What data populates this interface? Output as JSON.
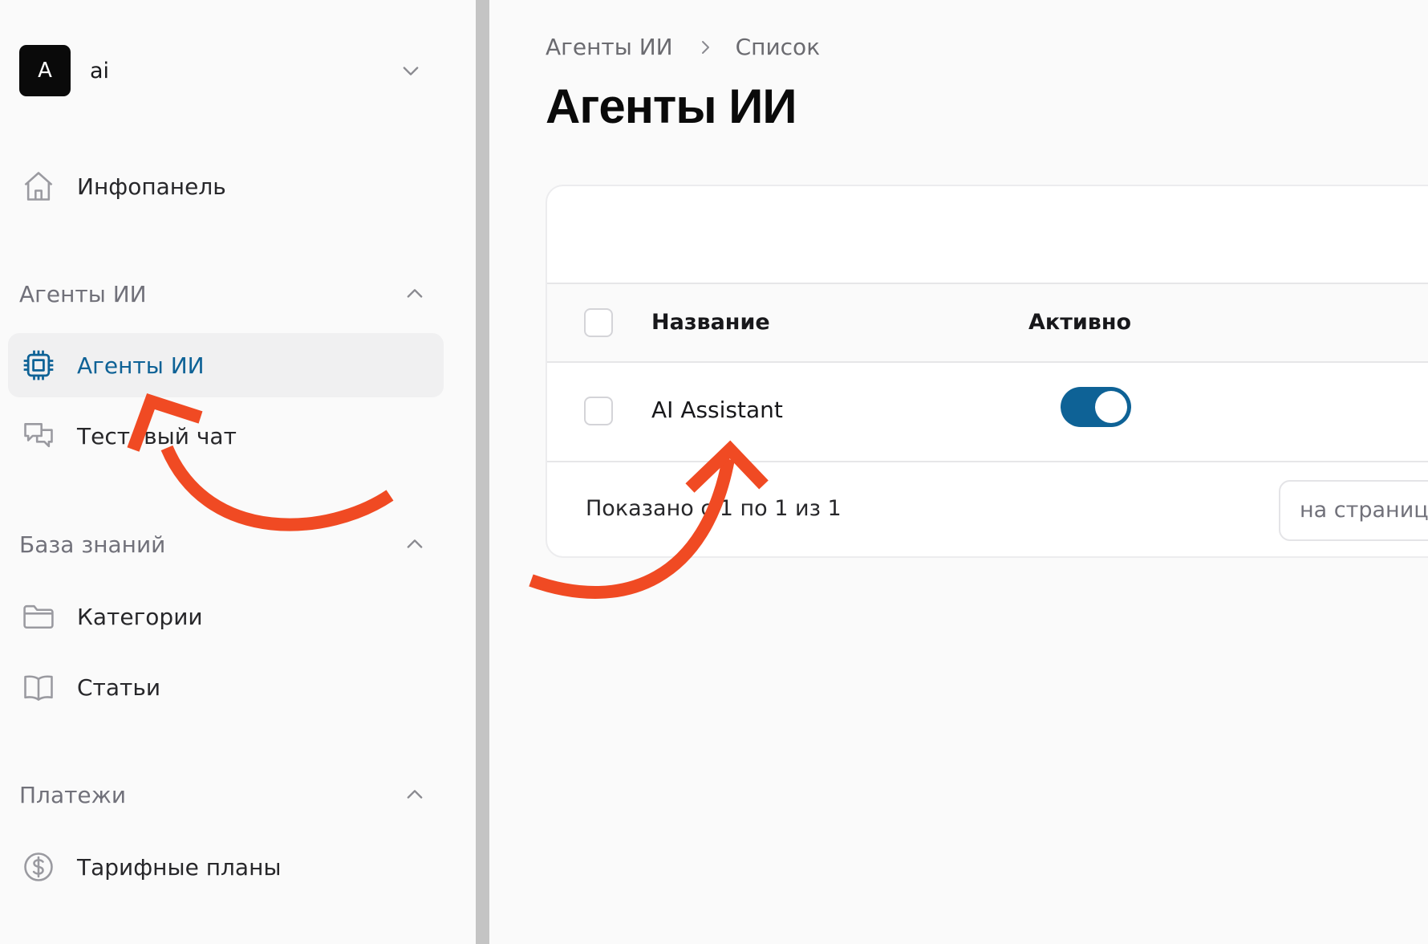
{
  "sidebar": {
    "tenant": {
      "initial": "A",
      "name": "ai"
    },
    "dashboard": {
      "label": "Инфопанель",
      "icon": "home-icon"
    },
    "groups": [
      {
        "label": "Агенты ИИ",
        "items": [
          {
            "label": "Агенты ИИ",
            "icon": "cpu-chip-icon",
            "active": true
          },
          {
            "label": "Тестовый чат",
            "icon": "chat-bubbles-icon"
          }
        ]
      },
      {
        "label": "База знаний",
        "items": [
          {
            "label": "Категории",
            "icon": "folder-icon"
          },
          {
            "label": "Статьи",
            "icon": "book-open-icon"
          }
        ]
      },
      {
        "label": "Платежи",
        "items": [
          {
            "label": "Тарифные планы",
            "icon": "dollar-circle-icon"
          }
        ]
      }
    ]
  },
  "main": {
    "breadcrumb": [
      "Агенты ИИ",
      "Список"
    ],
    "title": "Агенты ИИ",
    "table": {
      "columns": [
        "Название",
        "Активно"
      ],
      "rows": [
        {
          "name": "AI Assistant",
          "active": true
        }
      ],
      "footer": "Показано с 1 по 1 из 1",
      "per_page_label": "на страницу"
    }
  },
  "colors": {
    "accent": "#0e6296",
    "annotation_arrow": "#f04a23"
  }
}
